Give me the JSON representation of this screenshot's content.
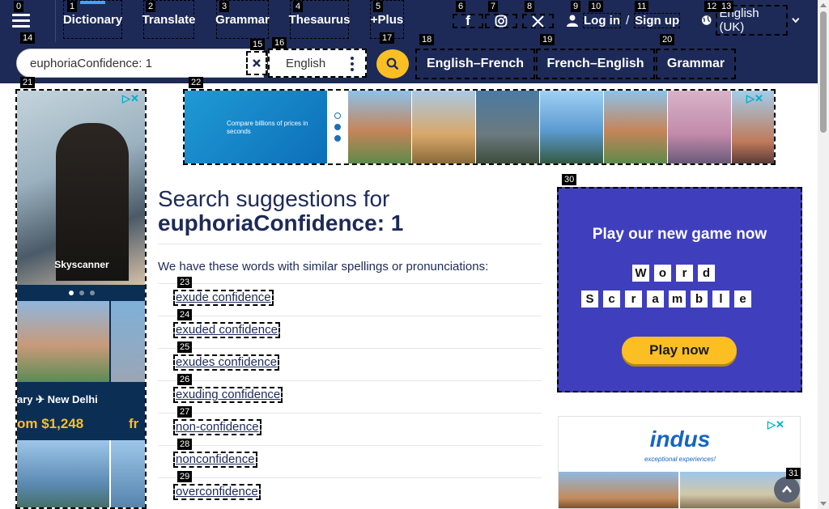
{
  "topnav": {
    "menu_tag": "0",
    "items": [
      {
        "tag": "1",
        "label": "Dictionary"
      },
      {
        "tag": "2",
        "label": "Translate"
      },
      {
        "tag": "3",
        "label": "Grammar"
      },
      {
        "tag": "4",
        "label": "Thesaurus"
      },
      {
        "tag": "5",
        "label": "+Plus"
      }
    ],
    "social": [
      {
        "tag": "6",
        "icon": "facebook-icon",
        "glyph": "f"
      },
      {
        "tag": "7",
        "icon": "instagram-icon",
        "glyph": "◎"
      },
      {
        "tag": "8",
        "icon": "x-icon",
        "glyph": "𝕏"
      }
    ],
    "login": {
      "tag_user": "9",
      "tag_login": "10",
      "tag_signup": "11",
      "login_label": "Log in",
      "separator": "/",
      "signup_label": "Sign up"
    },
    "language": {
      "tag_a": "12",
      "tag_b": "13",
      "label": "English (UK)"
    }
  },
  "search": {
    "input_tag": "14",
    "value": "euphoriaConfidence: 1",
    "clear_tag": "15",
    "lang_tag": "16",
    "lang_value": "English",
    "submit_tag": "17",
    "dict_links": [
      {
        "tag": "18",
        "label": "English–French"
      },
      {
        "tag": "19",
        "label": "French–English"
      },
      {
        "tag": "20",
        "label": "Grammar"
      }
    ]
  },
  "ads": {
    "left_tag": "21",
    "left_brand": "Skyscanner",
    "left_route": "ary ✈ New Delhi",
    "left_price": "om $1,248",
    "left_price_cut": "fr",
    "banner_tag": "22",
    "banner_text": "Compare billions of prices in seconds",
    "game_tag": "30",
    "game_title": "Play our new game now",
    "game_word1": [
      "W",
      "o",
      "r",
      "d"
    ],
    "game_word2": [
      "S",
      "c",
      "r",
      "a",
      "m",
      "b",
      "l",
      "e"
    ],
    "game_cta": "Play now",
    "indus_logo": "indus",
    "indus_tagline": "exceptional experiences!",
    "adchoice_glyph": "▷✕"
  },
  "results": {
    "heading_prefix": "Search suggestions for",
    "heading_query": "euphoriaConfidence: 1",
    "intro": "We have these words with similar spellings or pronunciations:",
    "suggestions": [
      {
        "tag": "23",
        "text": "exude confidence"
      },
      {
        "tag": "24",
        "text": "exuded confidence"
      },
      {
        "tag": "25",
        "text": "exudes confidence"
      },
      {
        "tag": "26",
        "text": "exuding confidence"
      },
      {
        "tag": "27",
        "text": "non-confidence"
      },
      {
        "tag": "28",
        "text": "nonconfidence"
      },
      {
        "tag": "29",
        "text": "overconfidence"
      }
    ]
  },
  "scroll_top_tag": "31",
  "colors": {
    "navy": "#1d2a57",
    "accent": "#fbbf24",
    "link_blue": "#3da5ff"
  }
}
